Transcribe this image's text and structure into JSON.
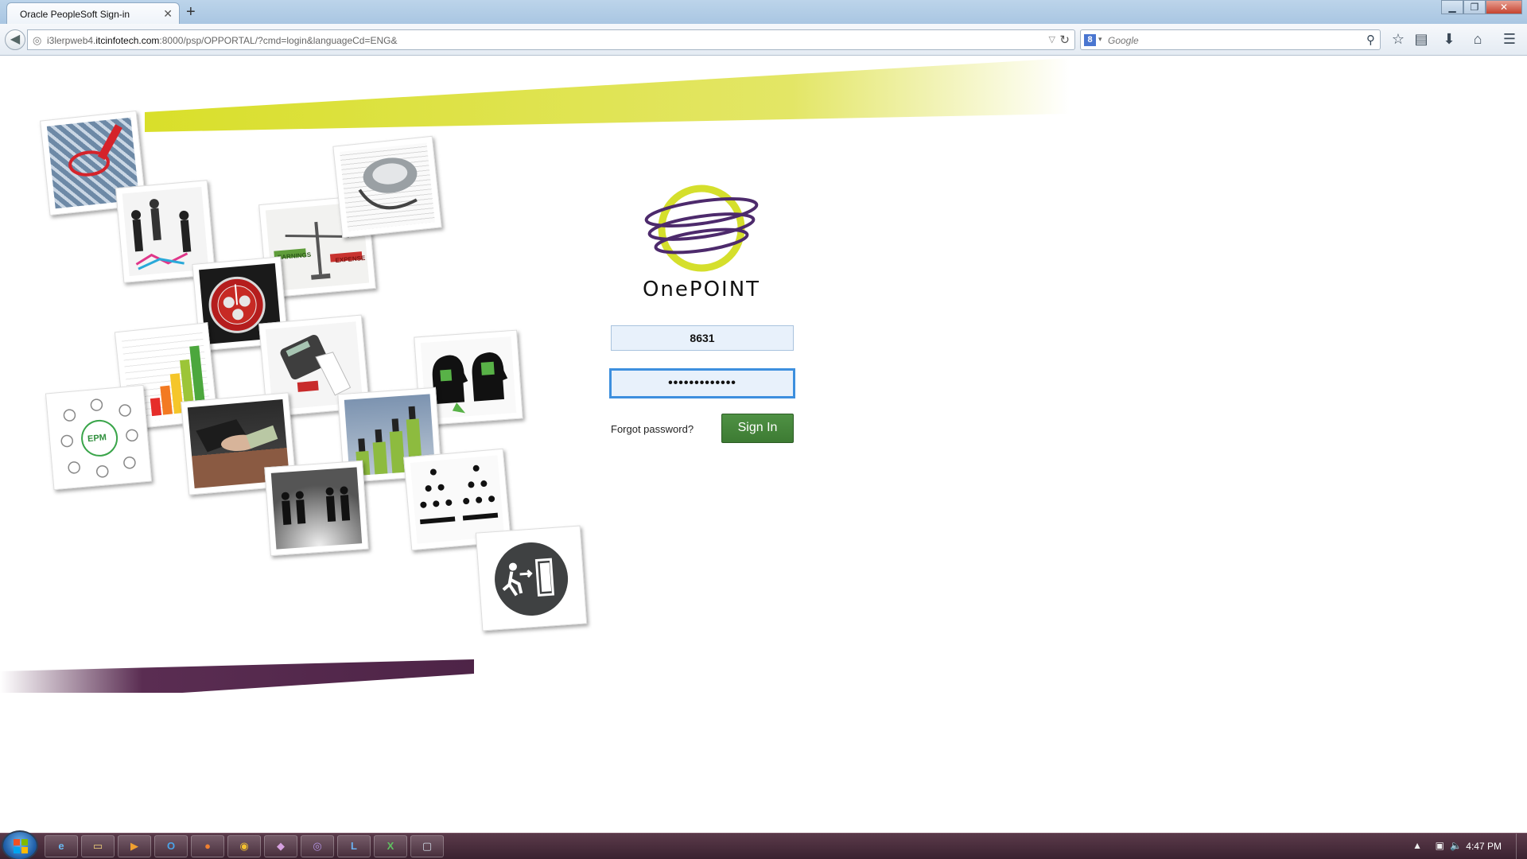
{
  "browser": {
    "tab_title": "Oracle PeopleSoft Sign-in",
    "tab_close": "✕",
    "new_tab": "+",
    "url_prefix": "i3lerpweb4.",
    "url_domain": "itcinfotech.com",
    "url_rest": ":8000/psp/OPPORTAL/?cmd=login&languageCd=ENG&",
    "search_engine": "Google",
    "search_placeholder": "Google"
  },
  "login": {
    "logo_text": "OnePOINT",
    "user_id": "8631",
    "password_masked": "•••••••••••••",
    "forgot_label": "Forgot password?",
    "signin_label": "Sign In"
  },
  "collage": {
    "epm_label": "EPM",
    "earnings_label": "EARNINGS",
    "expense_label": "EXPENSE"
  },
  "taskbar": {
    "clock": "4:47 PM",
    "apps": [
      "ie-icon",
      "explorer-icon",
      "media-player-icon",
      "outlook-icon",
      "firefox-icon",
      "chrome-icon",
      "app-icon",
      "app-icon-2",
      "lync-icon",
      "excel-icon",
      "window-icon"
    ]
  },
  "colors": {
    "accent_yellow": "#dbe038",
    "accent_purple": "#4e2447",
    "signin_green": "#46873b",
    "focus_blue": "#3d8fde"
  }
}
